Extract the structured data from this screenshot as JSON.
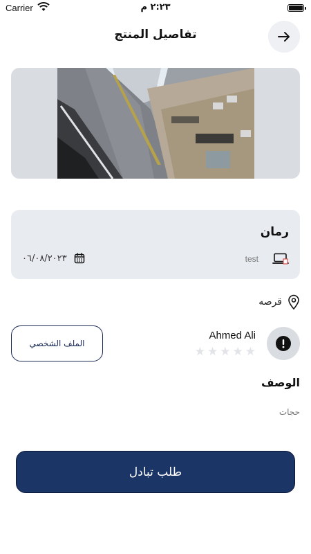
{
  "status_bar": {
    "carrier": "Carrier",
    "time": "٢:٢٣ م"
  },
  "header": {
    "title": "تفاصيل المنتج",
    "back_icon": "arrow-right-icon"
  },
  "product": {
    "image_icon": "street-photo",
    "name": "رمان",
    "category": "test",
    "category_icon": "laptop-icon",
    "date": "٠٦/٠٨/٢٠٢٣",
    "date_icon": "calendar-icon",
    "location": "قرصه",
    "location_icon": "location-pin-icon"
  },
  "seller": {
    "name": "Ahmed Ali",
    "avatar_icon": "alert-icon",
    "rating": 0,
    "rating_max": 5,
    "profile_button_label": "الملف الشخصي"
  },
  "description": {
    "heading": "الوصف",
    "text": "حجات"
  },
  "actions": {
    "exchange_label": "طلب تبادل"
  },
  "colors": {
    "primary": "#1b3566",
    "card_bg": "#e8ebf0",
    "star_inactive": "#e2e4e8"
  }
}
